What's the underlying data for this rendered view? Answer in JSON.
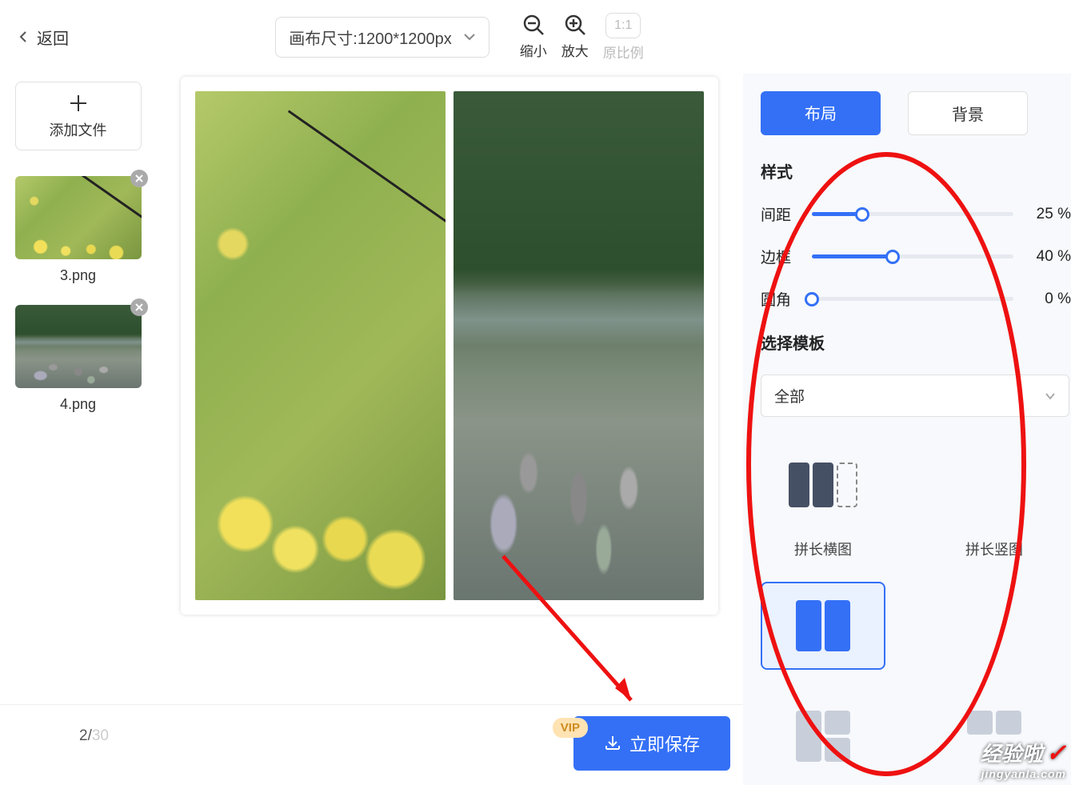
{
  "header": {
    "back_label": "返回",
    "canvas_size_label": "画布尺寸:1200*1200px",
    "zoom_out_label": "缩小",
    "zoom_in_label": "放大",
    "ratio_value": "1:1",
    "ratio_label": "原比例"
  },
  "left": {
    "add_file_label": "添加文件",
    "thumbs": [
      {
        "name": "3.png"
      },
      {
        "name": "4.png"
      }
    ],
    "page_current": "2",
    "page_sep": "/",
    "page_total": "30"
  },
  "actions": {
    "vip_label": "VIP",
    "save_label": "立即保存"
  },
  "right": {
    "tab_layout": "布局",
    "tab_background": "背景",
    "style_heading": "样式",
    "sliders": {
      "spacing": {
        "label": "间距",
        "value": "25",
        "unit": "%",
        "pct": 25
      },
      "border": {
        "label": "边框",
        "value": "40",
        "unit": "%",
        "pct": 40
      },
      "corner": {
        "label": "圆角",
        "value": "0",
        "unit": "%",
        "pct": 0
      }
    },
    "template_heading": "选择模板",
    "template_filter": "全部",
    "templates": [
      {
        "id": "long-h",
        "label": "拼长横图"
      },
      {
        "id": "long-v",
        "label": "拼长竖图"
      },
      {
        "id": "side2",
        "label": ""
      },
      {
        "id": "stack2",
        "label": ""
      },
      {
        "id": "grid3a",
        "label": ""
      },
      {
        "id": "grid3b",
        "label": ""
      }
    ]
  },
  "watermark": {
    "brand": "经验啦",
    "url": "jingyanla.com"
  }
}
